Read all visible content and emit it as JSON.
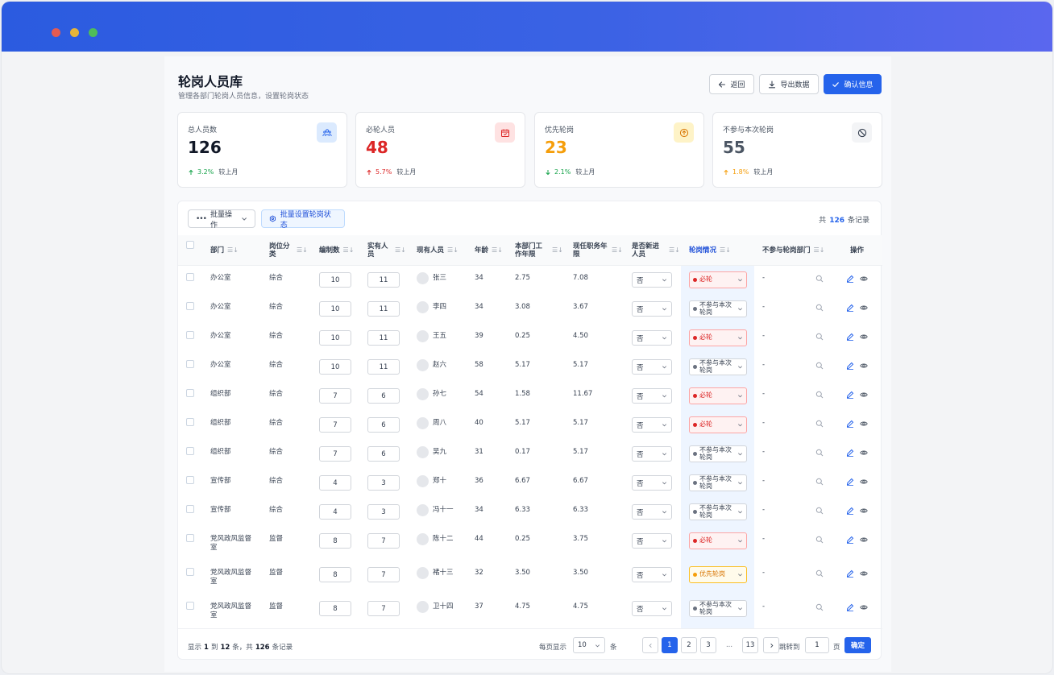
{
  "page": {
    "title": "轮岗人员库",
    "subtitle": "管理各部门轮岗人员信息，设置轮岗状态",
    "back_label": "返回",
    "export_label": "导出数据",
    "confirm_label": "确认信息"
  },
  "stats": [
    {
      "label": "总人员数",
      "value": "126",
      "trend": "3.2%",
      "trend_dir": "up",
      "compare": "较上月",
      "color": "#111827",
      "trend_color": "#16a34a",
      "icon": "users-icon",
      "icon_bg": "#dbeafe",
      "icon_color": "#2563eb"
    },
    {
      "label": "必轮人员",
      "value": "48",
      "trend": "5.7%",
      "trend_dir": "up",
      "compare": "较上月",
      "color": "#dc2626",
      "trend_color": "#dc2626",
      "icon": "calendar-icon",
      "icon_bg": "#fee2e2",
      "icon_color": "#dc2626"
    },
    {
      "label": "优先轮岗",
      "value": "23",
      "trend": "2.1%",
      "trend_dir": "down",
      "compare": "较上月",
      "color": "#f59e0b",
      "trend_color": "#16a34a",
      "icon": "arrow-up-circle-icon",
      "icon_bg": "#fef3c7",
      "icon_color": "#d97706"
    },
    {
      "label": "不参与本次轮岗",
      "value": "55",
      "trend": "1.8%",
      "trend_dir": "up",
      "compare": "较上月",
      "color": "#4b5563",
      "trend_color": "#f59e0b",
      "icon": "ban-icon",
      "icon_bg": "#f3f4f6",
      "icon_color": "#374151"
    }
  ],
  "toolbar": {
    "batch_ops": "批量操作",
    "batch_set": "批量设置轮岗状态",
    "total_prefix": "共",
    "total_count": "126",
    "total_suffix": "条记录"
  },
  "columns": [
    "部门",
    "岗位分类",
    "编制数",
    "实有人员",
    "现有人员",
    "年龄",
    "本部门工作年限",
    "现任职务年限",
    "是否新进人员",
    "轮岗情况",
    "不参与轮岗部门",
    "操作"
  ],
  "rows": [
    {
      "dept": "办公室",
      "cat": "综合",
      "quota": "10",
      "actual": "11",
      "name": "张三",
      "age": "34",
      "dept_years": "2.75",
      "post_years": "7.08",
      "new": "否",
      "rotation": "必轮",
      "rot_type": "must",
      "exclude": "-"
    },
    {
      "dept": "办公室",
      "cat": "综合",
      "quota": "10",
      "actual": "11",
      "name": "李四",
      "age": "34",
      "dept_years": "3.08",
      "post_years": "3.67",
      "new": "否",
      "rotation": "不参与本次轮岗",
      "rot_type": "none",
      "exclude": "-"
    },
    {
      "dept": "办公室",
      "cat": "综合",
      "quota": "10",
      "actual": "11",
      "name": "王五",
      "age": "39",
      "dept_years": "0.25",
      "post_years": "4.50",
      "new": "否",
      "rotation": "必轮",
      "rot_type": "must",
      "exclude": "-"
    },
    {
      "dept": "办公室",
      "cat": "综合",
      "quota": "10",
      "actual": "11",
      "name": "赵六",
      "age": "58",
      "dept_years": "5.17",
      "post_years": "5.17",
      "new": "否",
      "rotation": "不参与本次轮岗",
      "rot_type": "none",
      "exclude": "-"
    },
    {
      "dept": "组织部",
      "cat": "综合",
      "quota": "7",
      "actual": "6",
      "name": "孙七",
      "age": "54",
      "dept_years": "1.58",
      "post_years": "11.67",
      "new": "否",
      "rotation": "必轮",
      "rot_type": "must",
      "exclude": "-"
    },
    {
      "dept": "组织部",
      "cat": "综合",
      "quota": "7",
      "actual": "6",
      "name": "周八",
      "age": "40",
      "dept_years": "5.17",
      "post_years": "5.17",
      "new": "否",
      "rotation": "必轮",
      "rot_type": "must",
      "exclude": "-"
    },
    {
      "dept": "组织部",
      "cat": "综合",
      "quota": "7",
      "actual": "6",
      "name": "吴九",
      "age": "31",
      "dept_years": "0.17",
      "post_years": "5.17",
      "new": "否",
      "rotation": "不参与本次轮岗",
      "rot_type": "none",
      "exclude": "-"
    },
    {
      "dept": "宣传部",
      "cat": "综合",
      "quota": "4",
      "actual": "3",
      "name": "郑十",
      "age": "36",
      "dept_years": "6.67",
      "post_years": "6.67",
      "new": "否",
      "rotation": "不参与本次轮岗",
      "rot_type": "none",
      "exclude": "-"
    },
    {
      "dept": "宣传部",
      "cat": "综合",
      "quota": "4",
      "actual": "3",
      "name": "冯十一",
      "age": "34",
      "dept_years": "6.33",
      "post_years": "6.33",
      "new": "否",
      "rotation": "不参与本次轮岗",
      "rot_type": "none",
      "exclude": "-"
    },
    {
      "dept": "党风政风监督室",
      "cat": "监督",
      "quota": "8",
      "actual": "7",
      "name": "陈十二",
      "age": "44",
      "dept_years": "0.25",
      "post_years": "3.75",
      "new": "否",
      "rotation": "必轮",
      "rot_type": "must",
      "exclude": "-"
    },
    {
      "dept": "党风政风监督室",
      "cat": "监督",
      "quota": "8",
      "actual": "7",
      "name": "褚十三",
      "age": "32",
      "dept_years": "3.50",
      "post_years": "3.50",
      "new": "否",
      "rotation": "优先轮岗",
      "rot_type": "prio",
      "exclude": "-"
    },
    {
      "dept": "党风政风监督室",
      "cat": "监督",
      "quota": "8",
      "actual": "7",
      "name": "卫十四",
      "age": "37",
      "dept_years": "4.75",
      "post_years": "4.75",
      "new": "否",
      "rotation": "不参与本次轮岗",
      "rot_type": "none",
      "exclude": "-"
    }
  ],
  "footer": {
    "show": "显示",
    "from": "1",
    "to_word": "到",
    "to": "12",
    "count_word": "条，共",
    "total": "126",
    "records": "条记录",
    "per_page_label": "每页显示",
    "per_page": "10",
    "per_page_unit": "条",
    "pages": [
      "1",
      "2",
      "3",
      "...",
      "13"
    ],
    "current_page": "1",
    "jump_label": "跳转到",
    "jump_value": "1",
    "jump_unit": "页",
    "go_label": "确定"
  },
  "colors": {
    "accent": "#2563eb",
    "must": "#dc2626",
    "priority": "#f59e0b",
    "none": "#6b7280"
  }
}
